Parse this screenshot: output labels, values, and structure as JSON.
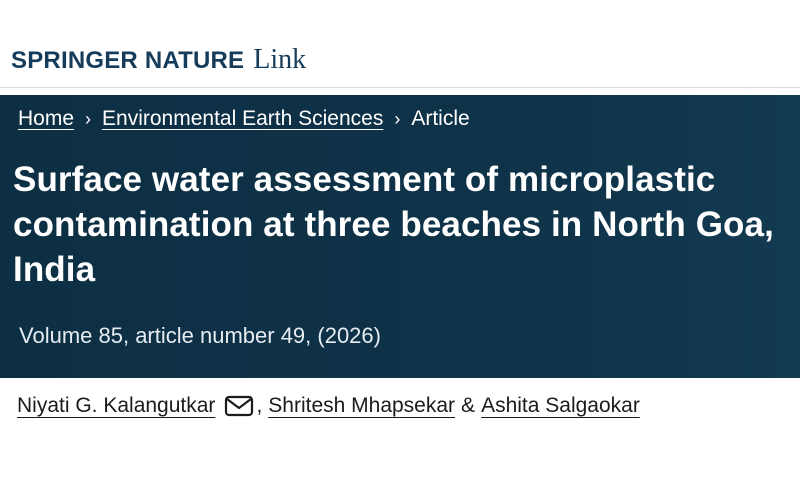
{
  "header": {
    "brand_springer": "SPRINGER NATURE",
    "brand_link": "Link"
  },
  "breadcrumb": {
    "items": [
      {
        "label": "Home"
      },
      {
        "label": "Environmental Earth Sciences"
      }
    ],
    "current": "Article",
    "separator": "›"
  },
  "article": {
    "title": "Surface water assessment of microplastic contamination at three beaches in North Goa, India",
    "volume_info": "Volume 85, article number 49, (2026)"
  },
  "authors": {
    "list": [
      {
        "name": "Niyati G. Kalangutkar",
        "corresponding": true
      },
      {
        "name": "Shritesh Mhapsekar"
      },
      {
        "name": "Ashita Salgaokar"
      }
    ],
    "comma": ",",
    "ampersand": "&"
  },
  "colors": {
    "hero_background": "#0e3248",
    "brand_text": "#163c5b",
    "hero_text": "#ffffff",
    "author_text": "#1b1b1b"
  },
  "icons": {
    "corresponding_author": "mail-icon",
    "breadcrumb_separator": "chevron-right-icon"
  }
}
